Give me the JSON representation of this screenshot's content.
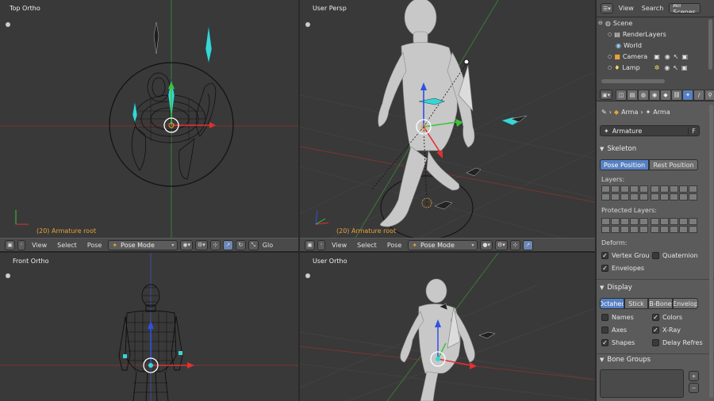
{
  "viewports": {
    "top_left": {
      "label": "Top Ortho",
      "status": "(20) Armature root"
    },
    "top_right": {
      "label": "User Persp",
      "status": "(20) Armature root"
    },
    "bottom_left": {
      "label": "Front Ortho"
    },
    "bottom_right": {
      "label": "User Ortho"
    }
  },
  "view_header": {
    "menus": [
      "View",
      "Select",
      "Pose"
    ],
    "mode": "Pose Mode",
    "pivot_label": "Glo"
  },
  "outliner": {
    "menus": [
      "View",
      "Search"
    ],
    "filter": "All Scenes",
    "items": [
      "Scene",
      "RenderLayers",
      "World",
      "Camera",
      "Lamp"
    ]
  },
  "properties": {
    "breadcrumb": [
      "Arma",
      "Arma"
    ],
    "datablock_name": "Armature",
    "datablock_fake_user": "F",
    "skeleton": {
      "header": "Skeleton",
      "pose_position": "Pose Position",
      "rest_position": "Rest Position",
      "layers_label": "Layers:",
      "protected_layers_label": "Protected Layers:",
      "deform_label": "Deform:",
      "vertex_groups": "Vertex Grou",
      "quaternion": "Quaternion",
      "envelopes": "Envelopes"
    },
    "display": {
      "header": "Display",
      "modes": [
        "Octahed",
        "Stick",
        "B-Bone",
        "Envelop"
      ],
      "names": "Names",
      "colors": "Colors",
      "axes": "Axes",
      "xray": "X-Ray",
      "shapes": "Shapes",
      "delay_refresh": "Delay Refres"
    },
    "bone_groups": {
      "header": "Bone Groups"
    },
    "checks": {
      "vertex_groups": true,
      "quaternion": false,
      "envelopes": true,
      "names": false,
      "colors": true,
      "axes": false,
      "xray": true,
      "shapes": true,
      "delay_refresh": false
    }
  },
  "colors": {
    "accent_blue": "#5680c2",
    "status_orange": "#e8a23a",
    "axis_red": "#e03030",
    "axis_green": "#3cc23c",
    "axis_blue": "#3050e0",
    "bone_cyan": "#38d6d6"
  }
}
